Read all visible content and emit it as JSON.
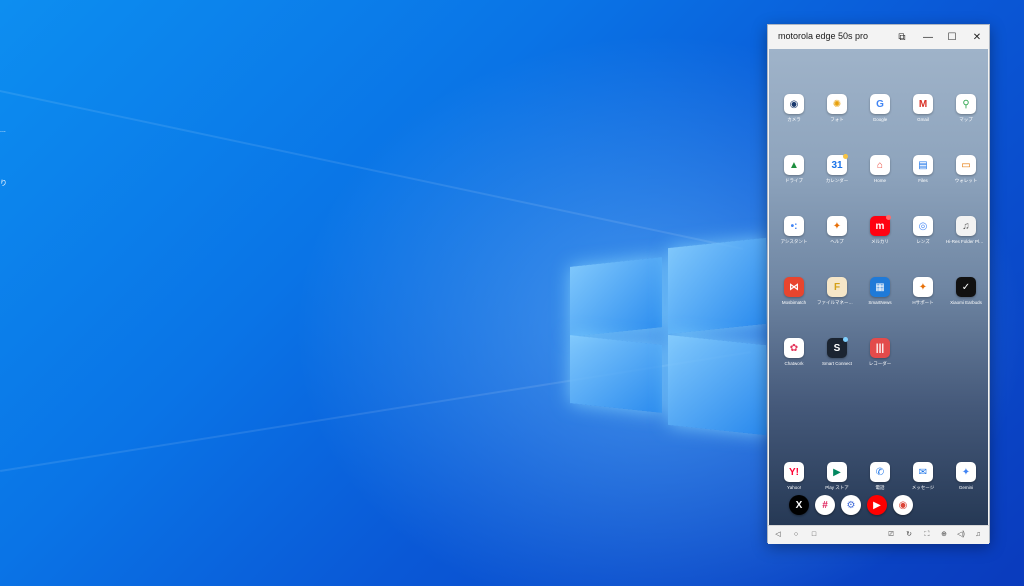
{
  "desktop": {
    "edge_label_1": "...",
    "edge_label_2": "り"
  },
  "window": {
    "title": "motorola edge 50s pro",
    "controls": [
      "screen-mirror",
      "minimize",
      "maximize",
      "close"
    ]
  },
  "apps": [
    {
      "label": "カメラ",
      "icon": "camera-icon",
      "bg": "#ffffff",
      "fg": "#1a3a6e",
      "glyph": "◉"
    },
    {
      "label": "フォト",
      "icon": "photos-icon",
      "bg": "#ffffff",
      "fg": "#e8a10c",
      "glyph": "✺"
    },
    {
      "label": "Google",
      "icon": "google-icon",
      "bg": "#ffffff",
      "fg": "#4285f4",
      "glyph": "G"
    },
    {
      "label": "Gmail",
      "icon": "gmail-icon",
      "bg": "#ffffff",
      "fg": "#d93025",
      "glyph": "M"
    },
    {
      "label": "マップ",
      "icon": "maps-icon",
      "bg": "#ffffff",
      "fg": "#34a853",
      "glyph": "⚲"
    },
    {
      "label": "ドライブ",
      "icon": "drive-icon",
      "bg": "#ffffff",
      "fg": "#1e8e3e",
      "glyph": "▲"
    },
    {
      "label": "カレンダー",
      "icon": "calendar-icon",
      "bg": "#ffffff",
      "fg": "#1a73e8",
      "glyph": "31",
      "badge": "#f6c343"
    },
    {
      "label": "Home",
      "icon": "home-icon",
      "bg": "#ffffff",
      "fg": "#ea4335",
      "glyph": "⌂"
    },
    {
      "label": "Files",
      "icon": "files-icon",
      "bg": "#ffffff",
      "fg": "#1a73e8",
      "glyph": "▤"
    },
    {
      "label": "ウォレット",
      "icon": "wallet-icon",
      "bg": "#ffffff",
      "fg": "#e37400",
      "glyph": "▭"
    },
    {
      "label": "アシスタント",
      "icon": "assistant-icon",
      "bg": "#ffffff",
      "fg": "#4285f4",
      "glyph": "•:"
    },
    {
      "label": "ヘルプ",
      "icon": "help-icon",
      "bg": "#ffffff",
      "fg": "#e8710a",
      "glyph": "✦"
    },
    {
      "label": "メルカリ",
      "icon": "mercari-icon",
      "bg": "#ff0211",
      "fg": "#ffffff",
      "glyph": "m",
      "badge": "#ff6b6b"
    },
    {
      "label": "レンズ",
      "icon": "lens-icon",
      "bg": "#ffffff",
      "fg": "#4285f4",
      "glyph": "◎"
    },
    {
      "label": "Hi-Res Folder Player Free",
      "icon": "music-player-icon",
      "bg": "#f2f2f2",
      "fg": "#555555",
      "glyph": "♫"
    },
    {
      "label": "Mosbimatch",
      "icon": "mosbimatch-icon",
      "bg": "#e8452e",
      "fg": "#ffffff",
      "glyph": "⋈"
    },
    {
      "label": "ファイルマネージャー",
      "icon": "file-manager-icon",
      "bg": "#f5e6c8",
      "fg": "#d4a017",
      "glyph": "F"
    },
    {
      "label": "SmartNews",
      "icon": "smartnews-icon",
      "bg": "#1f7ad8",
      "fg": "#ffffff",
      "glyph": "▦"
    },
    {
      "label": "Hサポート",
      "icon": "support-icon",
      "bg": "#ffffff",
      "fg": "#e8710a",
      "glyph": "✦"
    },
    {
      "label": "Xiaomi Earbuds",
      "icon": "earbuds-icon",
      "bg": "#111111",
      "fg": "#ffffff",
      "glyph": "✓"
    },
    {
      "label": "Chatwork",
      "icon": "chatwork-icon",
      "bg": "#ffffff",
      "fg": "#e4345a",
      "glyph": "✿"
    },
    {
      "label": "Smart Connect",
      "icon": "smart-connect-icon",
      "bg": "#1b2431",
      "fg": "#ffffff",
      "glyph": "S",
      "badge": "#7fd0ff"
    },
    {
      "label": "レコーダー",
      "icon": "recorder-icon",
      "bg": "#e34b4b",
      "fg": "#ffffff",
      "glyph": "|||"
    }
  ],
  "dock_apps": [
    {
      "label": "Yahoo!",
      "icon": "yahoo-icon",
      "bg": "#ffffff",
      "fg": "#ff0033",
      "glyph": "Y!"
    },
    {
      "label": "Play ストア",
      "icon": "play-store-icon",
      "bg": "#ffffff",
      "fg": "#01875f",
      "glyph": "▶"
    },
    {
      "label": "電話",
      "icon": "phone-icon",
      "bg": "#ffffff",
      "fg": "#1a73e8",
      "glyph": "✆"
    },
    {
      "label": "メッセージ",
      "icon": "messages-icon",
      "bg": "#ffffff",
      "fg": "#1a73e8",
      "glyph": "✉"
    },
    {
      "label": "Gemini",
      "icon": "gemini-icon",
      "bg": "#ffffff",
      "fg": "#4285f4",
      "glyph": "✦"
    }
  ],
  "tray_apps": [
    {
      "icon": "x-icon",
      "bg": "#000000",
      "fg": "#ffffff",
      "glyph": "X"
    },
    {
      "icon": "slack-icon",
      "bg": "#ffffff",
      "fg": "#e01e5a",
      "glyph": "#"
    },
    {
      "icon": "settings-icon",
      "bg": "#ffffff",
      "fg": "#3f6ad8",
      "glyph": "⚙"
    },
    {
      "icon": "youtube-icon",
      "bg": "#ff0000",
      "fg": "#ffffff",
      "glyph": "▶"
    },
    {
      "icon": "chrome-icon",
      "bg": "#ffffff",
      "fg": "#db4437",
      "glyph": "◉"
    }
  ],
  "navbar": {
    "left": [
      "back-icon",
      "home-circle-icon",
      "recents-icon"
    ],
    "right": [
      "cast-icon",
      "rotate-icon",
      "screenshot-icon",
      "lock-icon",
      "volume-icon",
      "notification-icon"
    ]
  }
}
